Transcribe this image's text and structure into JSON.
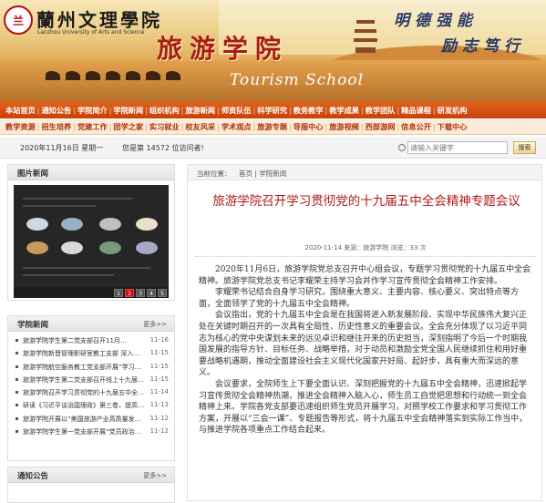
{
  "header": {
    "logo_text": "兰",
    "univ_name": "蘭州文理學院",
    "univ_en": "Lanzhou University of Arts and Science",
    "school_cn": "旅游学院",
    "school_en": "Tourism School",
    "motto_1": "明德强能",
    "motto_2": "励志笃行"
  },
  "nav_primary": [
    "本站首页",
    "通知公告",
    "学院简介",
    "学院新闻",
    "组织机构",
    "旅游新闻",
    "师资队伍",
    "科学研究",
    "教务教学",
    "教学成果",
    "教学团队",
    "精品课程",
    "研发机构"
  ],
  "nav_secondary": [
    "教学资源",
    "招生培养",
    "党建工作",
    "团学之家",
    "实习就业",
    "校友风采",
    "学术观点",
    "旅游专题",
    "导服中心",
    "旅游视频",
    "西部游网",
    "信息公开",
    "下载中心"
  ],
  "info_bar": {
    "date": "2020年11月16日 星期一",
    "visits": "您是第 14572 位访问者!",
    "search_placeholder": "请输入关键字",
    "search_button": "搜索"
  },
  "photo_panel": {
    "title": "图片新闻",
    "pages": [
      "1",
      "2",
      "3",
      "4",
      "5"
    ],
    "active_page": 2
  },
  "news_panel": {
    "title": "学院新闻",
    "more": "更多>>",
    "items": [
      {
        "title": "旅游学院学生第二党支部召开11月…",
        "date": "11-16"
      },
      {
        "title": "旅游学院新晋管理职研室教工支部 深入…",
        "date": "11-15"
      },
      {
        "title": "旅游学院航空服务教工党支部开展“学习…",
        "date": "11-15"
      },
      {
        "title": "旅游学院学生第二党支部召开线上十九届…",
        "date": "11-15"
      },
      {
        "title": "旅游学院召开学习贯彻党的十九届五中全…",
        "date": "11-14"
      },
      {
        "title": "研读《习近平谈治国理政》第三卷，提高…",
        "date": "11-13"
      },
      {
        "title": "旅游学院开展以“美国旅游产业高质量发…",
        "date": "11-12"
      },
      {
        "title": "旅游学院学生第一党支部开展“党员政治…",
        "date": "11-12"
      }
    ]
  },
  "notice_panel": {
    "title": "通知公告",
    "more": "更多>>"
  },
  "article": {
    "crumb_label": "当前位置：",
    "crumb_path": "首页 | 学院新闻",
    "title": "旅游学院召开学习贯彻党的十九届五中全会精神专题会议",
    "meta": "2020-11-14 来源：旅游学院 浏览：33 次",
    "paragraphs": [
      "2020年11月6日，旅游学院党总支召开中心组会议，专题学习贯彻党的十九届五中全会精神。旅游学院党总支书记李耀荣主持学习会并作学习宣传贯彻全会精神工作安排。",
      "李耀荣书记结合自身学习研究，围绕重大意义、主要内容、核心要义、突出特点等方面，全面领学了党的十九届五中全会精神。",
      "会议指出，党的十九届五中全会是在我国将进入新发展阶段、实现中华民族伟大复兴正处在关键时期召开的一次具有全局性、历史性意义的重要会议。全会充分体现了以习近平同志为核心的党中央谋划未来的远见卓识和继往开来的历史担当，深刻指明了今后一个时期我国发展的指导方针、目标任务、战略举措，对于动员和激励全党全国人民继续抓住和用好重要战略机遇期，推动全面建设社会主义现代化国家开好局、起好步，具有重大而深远的意义。",
      "会议要求，全院师生上下要全面认识、深刻把握党的十九届五中全会精神，迅速掀起学习宣传贯彻全会精神热潮，推进全会精神入脑入心，师生员工自觉把思想和行动统一到全会精神上来。学院各党支部要迅速组织师生党员开展学习，对照学校工作要求和学习贯彻工作方案，开展以“三会一课”、专题报告等形式，将十九届五中全会精神落实到实际工作当中，与推进学院各项重点工作结合起来。"
    ]
  }
}
